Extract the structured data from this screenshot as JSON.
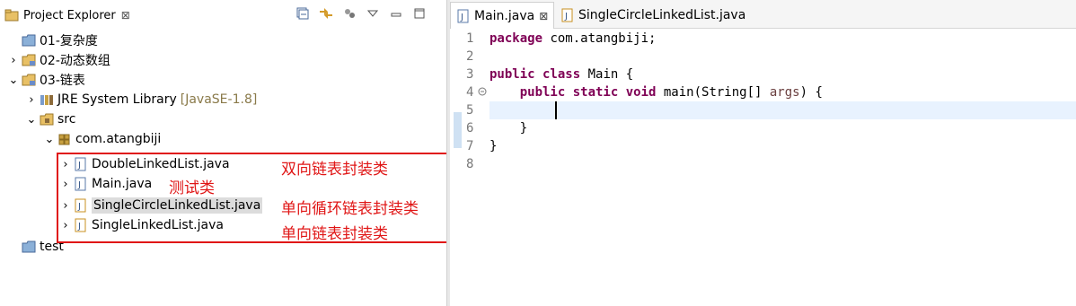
{
  "explorer": {
    "title": "Project Explorer",
    "close": "⊠",
    "toolbar": [
      "collapse-all-icon",
      "link-with-editor-icon",
      "focus-icon",
      "view-menu-icon",
      "minimize-icon",
      "maximize-icon"
    ],
    "tree": [
      {
        "label": "01-复杂度",
        "icon": "folder-icon",
        "twisty": ""
      },
      {
        "label": "02-动态数组",
        "icon": "project-icon",
        "twisty": "›"
      },
      {
        "label": "03-链表",
        "icon": "project-icon",
        "twisty": "⌄"
      },
      {
        "label": "JRE System Library",
        "decoration": "[JavaSE-1.8]",
        "icon": "library-icon",
        "twisty": "›"
      },
      {
        "label": "src",
        "icon": "source-folder-icon",
        "twisty": "⌄"
      },
      {
        "label": "com.atangbiji",
        "icon": "package-icon",
        "twisty": "⌄"
      },
      {
        "label": "DoubleLinkedList.java",
        "icon": "java-file-icon",
        "twisty": "›"
      },
      {
        "label": "Main.java",
        "icon": "java-file-icon",
        "twisty": "›"
      },
      {
        "label": "SingleCircleLinkedList.java",
        "icon": "java-file-icon",
        "twisty": "›",
        "selected": true
      },
      {
        "label": "SingleLinkedList.java",
        "icon": "java-file-icon",
        "twisty": "›"
      },
      {
        "label": "test",
        "icon": "folder-icon",
        "twisty": ""
      }
    ],
    "annotations": [
      "双向链表封装类",
      "测试类",
      "单向循环链表封装类",
      "单向链表封装类"
    ]
  },
  "editor": {
    "tabs": [
      {
        "title": "Main.java",
        "close": "⊠",
        "active": true
      },
      {
        "title": "SingleCircleLinkedList.java",
        "active": false
      }
    ],
    "line_numbers": [
      "1",
      "2",
      "3",
      "4",
      "5",
      "6",
      "7",
      "8"
    ],
    "code": {
      "l1_kw": "package",
      "l1_rest": " com.atangbiji;",
      "l3_kw": "public class",
      "l3_rest": " Main {",
      "l4_kw": "public static void",
      "l4_pre": " main(String[] ",
      "l4_param": "args",
      "l4_post": ") {",
      "l6": "    }",
      "l7": "}"
    }
  },
  "colors": {
    "keyword": "#7f0055",
    "annotation_red": "#e01616",
    "selection": "#dcdcdc",
    "current_line": "#e8f2fe"
  }
}
